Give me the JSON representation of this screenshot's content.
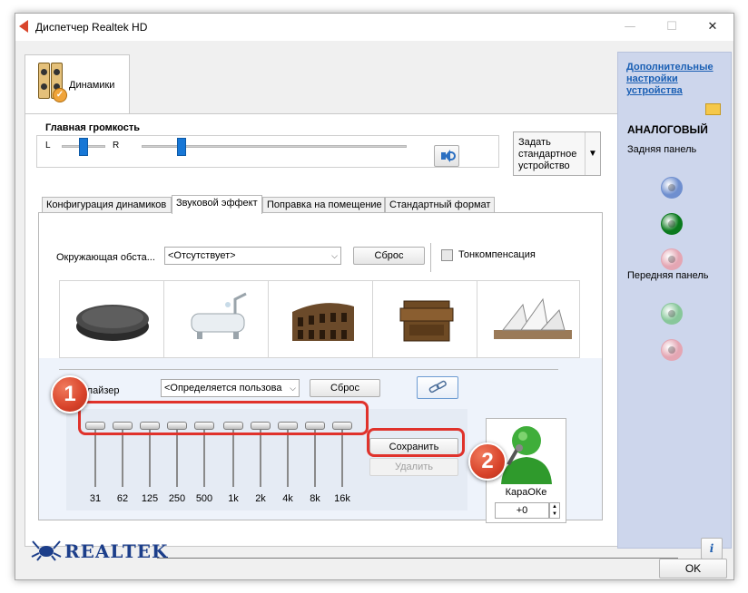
{
  "window": {
    "title": "Диспетчер Realtek HD",
    "minimize": "—",
    "maximize": "☐",
    "close": "✕"
  },
  "device_tab": {
    "label": "Динамики"
  },
  "volume": {
    "title": "Главная громкость",
    "left_label": "L",
    "right_label": "R",
    "balance_level": 0.5,
    "master_level": 0.15
  },
  "default_device_button": {
    "label": "Задать стандартное устройство"
  },
  "tabs": [
    {
      "label": "Конфигурация динамиков",
      "active": false
    },
    {
      "label": "Звуковой эффект",
      "active": true
    },
    {
      "label": "Поправка на помещение",
      "active": false
    },
    {
      "label": "Стандартный формат",
      "active": false
    }
  ],
  "environment": {
    "label": "Окружающая обста...",
    "select_value": "<Отсутствует>",
    "reset_label": "Сброс",
    "loudness_label": "Тонкомпенсация",
    "loudness_checked": false,
    "presets": [
      "stone-icon",
      "bathtub-icon",
      "colosseum-icon",
      "box-icon",
      "opera-house-icon"
    ]
  },
  "equalizer": {
    "label": "Эквалайзер",
    "visible_label": "квалайзер",
    "select_value": "<Определяется пользова",
    "reset_label": "Сброс",
    "bands": [
      "31",
      "62",
      "125",
      "250",
      "500",
      "1k",
      "2k",
      "4k",
      "8k",
      "16k"
    ],
    "save_label": "Сохранить",
    "delete_label": "Удалить"
  },
  "karaoke": {
    "label": "КараОКе",
    "value": "+0"
  },
  "callouts": {
    "first": "1",
    "second": "2"
  },
  "right_panel": {
    "link": "Дополнительные настройки устройства",
    "analog_title": "АНАЛОГОВЫЙ",
    "rear_panel": "Задняя панель",
    "front_panel": "Передняя панель",
    "rear_jacks": [
      "#6f8fcf",
      "#0b7a1e",
      "#e4a6b3"
    ],
    "front_jacks": [
      "#88c79a",
      "#e4a6b3"
    ]
  },
  "footer": {
    "brand": "Realtek",
    "brand_display": "REALTEK",
    "info_label": "i",
    "ok_label": "OK"
  }
}
